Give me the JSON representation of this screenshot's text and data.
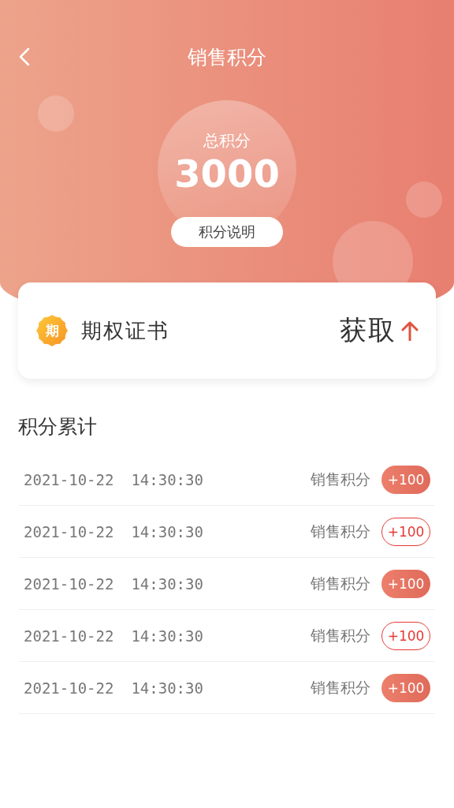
{
  "header": {
    "title": "销售积分",
    "total_label": "总积分",
    "total": "3000",
    "explain_button": "积分说明"
  },
  "certificate": {
    "badge_char": "期",
    "title": "期权证书",
    "action": "获取"
  },
  "records": {
    "title": "积分累计",
    "rows": [
      {
        "date": "2021-10-22",
        "time": "14:30:30",
        "label": "销售积分",
        "points": "+100",
        "kind": "filled"
      },
      {
        "date": "2021-10-22",
        "time": "14:30:30",
        "label": "销售积分",
        "points": "+100",
        "kind": "outline"
      },
      {
        "date": "2021-10-22",
        "time": "14:30:30",
        "label": "销售积分",
        "points": "+100",
        "kind": "filled"
      },
      {
        "date": "2021-10-22",
        "time": "14:30:30",
        "label": "销售积分",
        "points": "+100",
        "kind": "outline"
      },
      {
        "date": "2021-10-22",
        "time": "14:30:30",
        "label": "销售积分",
        "points": "+100",
        "kind": "filled"
      }
    ]
  }
}
